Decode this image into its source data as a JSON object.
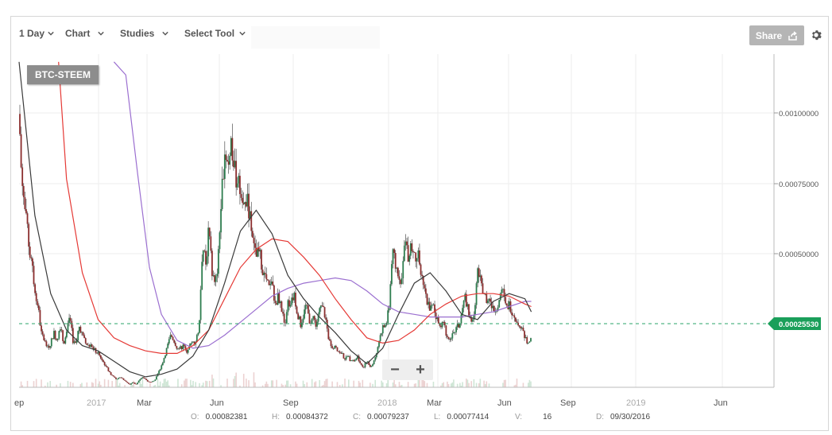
{
  "toolbar": {
    "period": "1 Day",
    "chart": "Chart",
    "studies": "Studies",
    "select_tool": "Select Tool",
    "share": "Share"
  },
  "symbol": "BTC-STEEM",
  "icons": [
    "chevron-down-icon",
    "share-icon",
    "gear-icon"
  ],
  "price_axis": {
    "ticks": [
      "0.00100000",
      "0.00075000",
      "0.00050000"
    ],
    "current_price": "0.00025530",
    "current_color": "#1a9f5a"
  },
  "time_axis": {
    "ticks": [
      "ep",
      "2017",
      "Mar",
      "Jun",
      "Sep",
      "2018",
      "Mar",
      "Jun",
      "Sep",
      "2019",
      "Jun"
    ]
  },
  "zoom": {
    "out": "−",
    "in": "+"
  },
  "ohlc": {
    "o_label": "O:",
    "o": "0.00082381",
    "h_label": "H:",
    "h": "0.00084372",
    "c_label": "C:",
    "c": "0.00079237",
    "l_label": "L:",
    "l": "0.00077414",
    "v_label": "V:",
    "v": "16",
    "d_label": "D:",
    "d": "09/30/2016"
  },
  "colors": {
    "up": "#2e7d4f",
    "down": "#8b2e2e",
    "ma_dark": "#3a3a3a",
    "ma_red": "#e53935",
    "ma_purple": "#9b6fd0",
    "price_line": "#2aa56a"
  },
  "chart_data": {
    "type": "line",
    "price_close": [
      [
        0,
        0.00105
      ],
      [
        3,
        0.00082
      ],
      [
        8,
        0.00066
      ],
      [
        14,
        0.00051
      ],
      [
        19,
        0.0004
      ],
      [
        24,
        0.00031
      ],
      [
        28,
        0.00021
      ],
      [
        32,
        0.00018
      ],
      [
        36,
        0.00015
      ],
      [
        40,
        0.00017
      ],
      [
        44,
        0.00021
      ],
      [
        48,
        0.00018
      ],
      [
        52,
        0.00024
      ],
      [
        56,
        0.00017
      ],
      [
        60,
        0.0002
      ],
      [
        64,
        0.00028
      ],
      [
        68,
        0.00018
      ],
      [
        72,
        0.00016
      ],
      [
        76,
        0.00024
      ],
      [
        80,
        0.0002
      ],
      [
        84,
        0.00017
      ],
      [
        88,
        0.00016
      ],
      [
        92,
        0.00016
      ],
      [
        96,
        0.00014
      ],
      [
        100,
        0.00013
      ],
      [
        104,
        0.00011
      ],
      [
        108,
        9e-05
      ],
      [
        112,
        7e-05
      ],
      [
        116,
        5e-05
      ],
      [
        120,
        4e-05
      ],
      [
        124,
        3e-05
      ],
      [
        128,
        4e-05
      ],
      [
        132,
        3e-05
      ],
      [
        136,
        2e-05
      ],
      [
        140,
        1e-05
      ],
      [
        144,
        2e-05
      ],
      [
        148,
        1e-05
      ],
      [
        152,
        3e-05
      ],
      [
        156,
        4e-05
      ],
      [
        160,
        3e-05
      ],
      [
        164,
        2e-05
      ],
      [
        168,
        2e-05
      ],
      [
        172,
        3e-05
      ],
      [
        176,
        6e-05
      ],
      [
        180,
        8e-05
      ],
      [
        184,
        0.00012
      ],
      [
        188,
        0.00016
      ],
      [
        192,
        0.0002
      ],
      [
        196,
        0.00018
      ],
      [
        200,
        0.00015
      ],
      [
        204,
        0.00015
      ],
      [
        208,
        0.00016
      ],
      [
        212,
        0.00014
      ],
      [
        216,
        0.00016
      ],
      [
        220,
        0.00017
      ],
      [
        224,
        0.00018
      ],
      [
        228,
        0.00024
      ],
      [
        232,
        0.00055
      ],
      [
        236,
        0.00047
      ],
      [
        240,
        0.0006
      ],
      [
        244,
        0.00045
      ],
      [
        248,
        0.00038
      ],
      [
        252,
        0.0005
      ],
      [
        256,
        0.00072
      ],
      [
        260,
        0.00092
      ],
      [
        264,
        0.00086
      ],
      [
        268,
        0.00095
      ],
      [
        272,
        0.00083
      ],
      [
        276,
        0.0008
      ],
      [
        280,
        0.00075
      ],
      [
        284,
        0.00069
      ],
      [
        288,
        0.00072
      ],
      [
        292,
        0.00066
      ],
      [
        296,
        0.00054
      ],
      [
        300,
        0.0005
      ],
      [
        304,
        0.00052
      ],
      [
        308,
        0.00044
      ],
      [
        312,
        0.00042
      ],
      [
        316,
        0.00038
      ],
      [
        320,
        0.00039
      ],
      [
        324,
        0.00032
      ],
      [
        328,
        0.00035
      ],
      [
        332,
        0.0003
      ],
      [
        336,
        0.00024
      ],
      [
        340,
        0.00033
      ],
      [
        344,
        0.00032
      ],
      [
        348,
        0.00035
      ],
      [
        352,
        0.00029
      ],
      [
        356,
        0.00024
      ],
      [
        360,
        0.00028
      ],
      [
        364,
        0.00031
      ],
      [
        368,
        0.00025
      ],
      [
        372,
        0.00027
      ],
      [
        376,
        0.00024
      ],
      [
        380,
        0.00029
      ],
      [
        384,
        0.00031
      ],
      [
        388,
        0.00026
      ],
      [
        392,
        0.00018
      ],
      [
        396,
        0.00016
      ],
      [
        400,
        0.00015
      ],
      [
        404,
        0.00014
      ],
      [
        408,
        0.00013
      ],
      [
        412,
        0.00011
      ],
      [
        416,
        0.00012
      ],
      [
        420,
        0.0001
      ],
      [
        424,
        0.0001
      ],
      [
        428,
        0.00012
      ],
      [
        432,
        9e-05
      ],
      [
        436,
        8e-05
      ],
      [
        440,
        0.0001
      ],
      [
        444,
        8e-05
      ],
      [
        448,
        9e-05
      ],
      [
        452,
        0.00013
      ],
      [
        456,
        0.00019
      ],
      [
        460,
        0.00023
      ],
      [
        464,
        0.00024
      ],
      [
        468,
        0.0003
      ],
      [
        472,
        0.00052
      ],
      [
        476,
        0.00047
      ],
      [
        480,
        0.00044
      ],
      [
        484,
        0.00041
      ],
      [
        488,
        0.00056
      ],
      [
        492,
        0.00051
      ],
      [
        496,
        0.00055
      ],
      [
        500,
        0.00049
      ],
      [
        504,
        0.00053
      ],
      [
        508,
        0.00044
      ],
      [
        512,
        0.00039
      ],
      [
        516,
        0.00034
      ],
      [
        520,
        0.0003
      ],
      [
        524,
        0.00031
      ],
      [
        528,
        0.00027
      ],
      [
        532,
        0.00023
      ],
      [
        536,
        0.00026
      ],
      [
        540,
        0.00021
      ],
      [
        544,
        0.00018
      ],
      [
        548,
        0.0002
      ],
      [
        552,
        0.00022
      ],
      [
        556,
        0.00024
      ],
      [
        560,
        0.00027
      ],
      [
        564,
        0.00035
      ],
      [
        568,
        0.0003
      ],
      [
        572,
        0.00026
      ],
      [
        576,
        0.00029
      ],
      [
        580,
        0.00045
      ],
      [
        584,
        0.0004
      ],
      [
        588,
        0.00036
      ],
      [
        592,
        0.00034
      ],
      [
        596,
        0.00033
      ],
      [
        600,
        0.00029
      ],
      [
        604,
        0.00031
      ],
      [
        608,
        0.00033
      ],
      [
        612,
        0.00038
      ],
      [
        616,
        0.0003
      ],
      [
        620,
        0.00032
      ],
      [
        624,
        0.00029
      ],
      [
        628,
        0.00027
      ],
      [
        632,
        0.00024
      ],
      [
        636,
        0.00022
      ],
      [
        640,
        0.00019
      ],
      [
        644,
        0.00016
      ],
      [
        648,
        0.0002
      ]
    ],
    "ma_dark": [
      [
        0,
        0.00125
      ],
      [
        20,
        0.00066
      ],
      [
        40,
        0.00036
      ],
      [
        60,
        0.00022
      ],
      [
        80,
        0.00016
      ],
      [
        100,
        0.00014
      ],
      [
        120,
        0.0001
      ],
      [
        140,
        6e-05
      ],
      [
        160,
        4e-05
      ],
      [
        180,
        5e-05
      ],
      [
        200,
        7e-05
      ],
      [
        220,
        0.00012
      ],
      [
        240,
        0.00022
      ],
      [
        260,
        0.0004
      ],
      [
        280,
        0.0006
      ],
      [
        300,
        0.00068
      ],
      [
        320,
        0.00059
      ],
      [
        340,
        0.00043
      ],
      [
        360,
        0.00034
      ],
      [
        380,
        0.00027
      ],
      [
        400,
        0.00021
      ],
      [
        420,
        0.00014
      ],
      [
        440,
        9e-05
      ],
      [
        460,
        0.00015
      ],
      [
        480,
        0.00028
      ],
      [
        500,
        0.0004
      ],
      [
        520,
        0.00044
      ],
      [
        540,
        0.00037
      ],
      [
        560,
        0.00028
      ],
      [
        580,
        0.00026
      ],
      [
        600,
        0.00033
      ],
      [
        620,
        0.00036
      ],
      [
        640,
        0.00034
      ],
      [
        648,
        0.00029
      ]
    ],
    "ma_red": [
      [
        50,
        0.00125
      ],
      [
        60,
        0.0008
      ],
      [
        80,
        0.00044
      ],
      [
        100,
        0.00026
      ],
      [
        120,
        0.00019
      ],
      [
        140,
        0.00016
      ],
      [
        160,
        0.00014
      ],
      [
        180,
        0.00013
      ],
      [
        200,
        0.00013
      ],
      [
        220,
        0.00016
      ],
      [
        240,
        0.00022
      ],
      [
        260,
        0.00034
      ],
      [
        280,
        0.00046
      ],
      [
        300,
        0.00053
      ],
      [
        320,
        0.00057
      ],
      [
        340,
        0.00056
      ],
      [
        360,
        0.0005
      ],
      [
        380,
        0.00043
      ],
      [
        400,
        0.00034
      ],
      [
        420,
        0.00026
      ],
      [
        440,
        0.00019
      ],
      [
        460,
        0.00017
      ],
      [
        480,
        0.00018
      ],
      [
        500,
        0.00022
      ],
      [
        520,
        0.00028
      ],
      [
        540,
        0.00032
      ],
      [
        560,
        0.00035
      ],
      [
        580,
        0.00036
      ],
      [
        600,
        0.00036
      ],
      [
        620,
        0.00035
      ],
      [
        640,
        0.00032
      ],
      [
        648,
        0.00031
      ]
    ],
    "ma_purple": [
      [
        120,
        0.00125
      ],
      [
        135,
        0.0012
      ],
      [
        150,
        0.00082
      ],
      [
        165,
        0.00046
      ],
      [
        180,
        0.00028
      ],
      [
        200,
        0.00018
      ],
      [
        220,
        0.00015
      ],
      [
        240,
        0.00016
      ],
      [
        260,
        0.0002
      ],
      [
        280,
        0.00025
      ],
      [
        300,
        0.0003
      ],
      [
        320,
        0.00035
      ],
      [
        340,
        0.00038
      ],
      [
        360,
        0.0004
      ],
      [
        380,
        0.00041
      ],
      [
        400,
        0.00042
      ],
      [
        420,
        0.00041
      ],
      [
        440,
        0.00037
      ],
      [
        460,
        0.00032
      ],
      [
        480,
        0.00029
      ],
      [
        500,
        0.00028
      ],
      [
        520,
        0.00027
      ],
      [
        540,
        0.00027
      ],
      [
        560,
        0.00027
      ],
      [
        580,
        0.00028
      ],
      [
        600,
        0.00029
      ],
      [
        620,
        0.00031
      ],
      [
        640,
        0.00033
      ],
      [
        648,
        0.00033
      ]
    ],
    "ylim": [
      0,
      0.00128
    ],
    "xlim": [
      0,
      950
    ]
  }
}
